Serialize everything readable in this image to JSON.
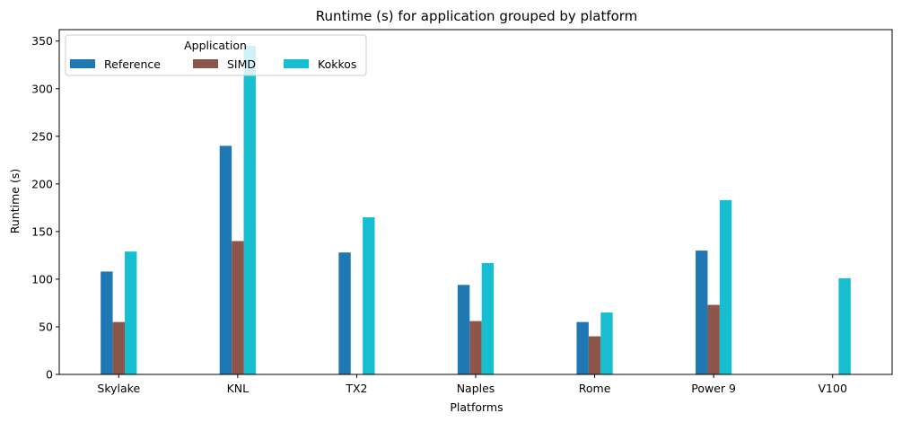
{
  "chart_data": {
    "type": "bar",
    "title": "Runtime (s) for application grouped by platform",
    "xlabel": "Platforms",
    "ylabel": "Runtime (s)",
    "categories": [
      "Skylake",
      "KNL",
      "TX2",
      "Naples",
      "Rome",
      "Power 9",
      "V100"
    ],
    "series": [
      {
        "name": "Reference",
        "color": "#1f77b4",
        "values": [
          108,
          240,
          128,
          94,
          55,
          130,
          null
        ]
      },
      {
        "name": "SIMD",
        "color": "#8c564b",
        "values": [
          55,
          140,
          null,
          56,
          40,
          73,
          null
        ]
      },
      {
        "name": "Kokkos",
        "color": "#17becf",
        "values": [
          129,
          345,
          165,
          117,
          65,
          183,
          101
        ]
      }
    ],
    "ylim": [
      0,
      362
    ],
    "yticks": [
      0,
      50,
      100,
      150,
      200,
      250,
      300,
      350
    ],
    "legend": {
      "title": "Application",
      "placement": "top-left",
      "ncol": 3
    },
    "grid": false
  }
}
